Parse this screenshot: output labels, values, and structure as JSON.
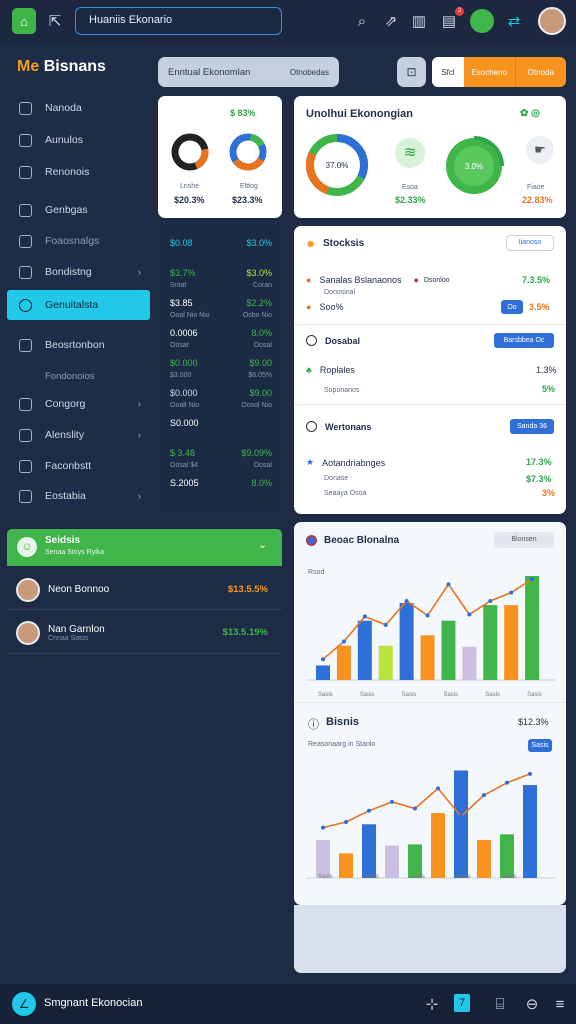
{
  "topbar": {
    "search_value": "Huaniis Ekonario",
    "icons": [
      "home-logo",
      "collapse-icon",
      "search-icon",
      "share-icon",
      "chart-icon",
      "notification-icon",
      "chat-icon",
      "swap-icon",
      "avatar"
    ],
    "badge_count": "2"
  },
  "sidebar": {
    "brand_prefix": "Me",
    "brand_name": "Bisnans",
    "items": [
      {
        "label": "Nanoda",
        "icon": "edit-icon"
      },
      {
        "label": "Aunulos",
        "icon": "shield-icon"
      },
      {
        "label": "Renonois",
        "icon": "grid-icon"
      },
      {
        "label": "Genbgas",
        "icon": "circle-icon"
      },
      {
        "label": "Foaosnalgs",
        "icon": "square-icon",
        "dim": true
      },
      {
        "label": "Bondistng",
        "icon": "a-icon",
        "chevron": true
      },
      {
        "label": "Genuitalsta",
        "icon": "person-icon",
        "active": true
      },
      {
        "label": "Beosrtonbon",
        "icon": "globe-icon"
      },
      {
        "label": "Fondonoios",
        "icon": "",
        "sub": true
      },
      {
        "label": "Congorg",
        "icon": "link-icon",
        "chevron": true
      },
      {
        "label": "Alenslity",
        "icon": "folder-icon",
        "chevron": true
      },
      {
        "label": "Faconbstt",
        "icon": "book-icon"
      },
      {
        "label": "Eostabia",
        "icon": "table-icon",
        "chevron": true
      }
    ]
  },
  "header": {
    "search_label": "Enntual Ekonomlan",
    "search_hint": "Otnobedas",
    "tab_small": "Sfcl",
    "tab_orange_1": "Esocheno",
    "tab_orange_2": "Otnoda"
  },
  "stats_small": {
    "corner": "$ 83%",
    "items": [
      {
        "label": "Lnshe",
        "value": "$20.3%"
      },
      {
        "label": "Elttog",
        "value": "$23.3%"
      }
    ]
  },
  "stats_wide": {
    "title": "Unolhui Ekonongian",
    "items": [
      {
        "center": "37.0%",
        "label": "",
        "value": ""
      },
      {
        "label": "Esoa",
        "value": "$2.33%"
      },
      {
        "center": "3.0%",
        "label": "",
        "value": ""
      },
      {
        "label": "Fiaoe",
        "value": "22.83%"
      }
    ]
  },
  "midlist": {
    "rows": [
      {
        "a": "$0.08",
        "b": "$3.0%",
        "sa": "",
        "sb": ""
      },
      {
        "a": "$3.7%",
        "b": "$3.0%",
        "sa": "Sntat",
        "sb": "Coran"
      },
      {
        "a": "$3.85",
        "b": "$2.2%",
        "sa": "Ooal Nio Nio",
        "sb": "Osbo Nio"
      },
      {
        "a": "0.0006",
        "b": "8.0%",
        "sa": "Oosat",
        "sb": "Oosal"
      },
      {
        "a": "$0.000",
        "b": "$9.00",
        "sa": "$3.000",
        "sb": "$8.05%"
      },
      {
        "a": "$0.000",
        "b": "$9.00",
        "sa": "Ooalt Nio",
        "sb": "Oosol Nio"
      },
      {
        "a": "S0.000",
        "b": "",
        "sa": "",
        "sb": ""
      },
      {
        "a": "$ 3.48",
        "b": "$9.09%",
        "sa": "Oosal $4",
        "sb": "Oosal"
      },
      {
        "a": "S.2005",
        "b": "8.0%",
        "sa": "",
        "sb": ""
      }
    ]
  },
  "stocks": {
    "title": "Stocksis",
    "filter": "Iianoso",
    "r1_label": "Sanalas Bslanaonos",
    "r1_sub": "Dsonloo",
    "r1_value": "7.3.5%",
    "r1_sub2": "Donosinal",
    "r2_label": "Soo%",
    "r2_btn": "Oo",
    "r2_value": "3.5%",
    "s2_title": "Dosabal",
    "s2_btn": "Barsbbea Oc",
    "s3_label": "Roplales",
    "s3_sub": "Soponanos",
    "s3_v1": "1.3%",
    "s3_v2": "5%",
    "s4_title": "Wertonans",
    "s4_btn": "Sanda 36",
    "s5_label": "Aotandriabnges",
    "s5_sub1": "Donase",
    "s5_sub2": "Seaaya Osoa",
    "s5_v1": "17.3%",
    "s5_v2": "$7.3%",
    "s5_v3": "3%"
  },
  "leftbottom": {
    "bar_title": "Seidsis",
    "bar_sub": "Senaa Stoys Rylka",
    "people": [
      {
        "name": "Neon Bonnoo",
        "value": "$13.5.5%"
      },
      {
        "name": "Nan Garnlon",
        "sub": "Cnnaa Satos",
        "value": "$13.5.19%"
      }
    ]
  },
  "chart1": {
    "title": "Beoac Blonalna",
    "badge": "Blonsen",
    "ylabel": "Rsod",
    "tick": "Sasis"
  },
  "chart2": {
    "title": "Bisnis",
    "value": "$12.3%",
    "sub": "Reasonaarg in Stanlo",
    "btn": "Sasis"
  },
  "chart_data": [
    {
      "type": "bar",
      "title": "Beoac Blonalna",
      "ylabel": "Rsod",
      "values": [
        0.14,
        0.33,
        0.57,
        0.33,
        0.74,
        0.43,
        0.57,
        0.32,
        0.72,
        0.72,
        1.0
      ],
      "series": [
        {
          "name": "",
          "values": [
            0.2,
            0.37,
            0.61,
            0.53,
            0.76,
            0.62,
            0.92,
            0.63,
            0.76,
            0.84,
            0.97
          ]
        }
      ]
    },
    {
      "type": "bar",
      "title": "Bisnis",
      "values": [
        0.34,
        0.22,
        0.48,
        0.29,
        0.3,
        0.58,
        0.96,
        0.34,
        0.39,
        0.83
      ],
      "series": [
        {
          "name": "",
          "values": [
            0.45,
            0.5,
            0.6,
            0.68,
            0.62,
            0.8,
            0.55,
            0.74,
            0.85,
            0.93
          ]
        }
      ]
    }
  ],
  "bottombar": {
    "title": "Smgnant Ekonocian"
  }
}
